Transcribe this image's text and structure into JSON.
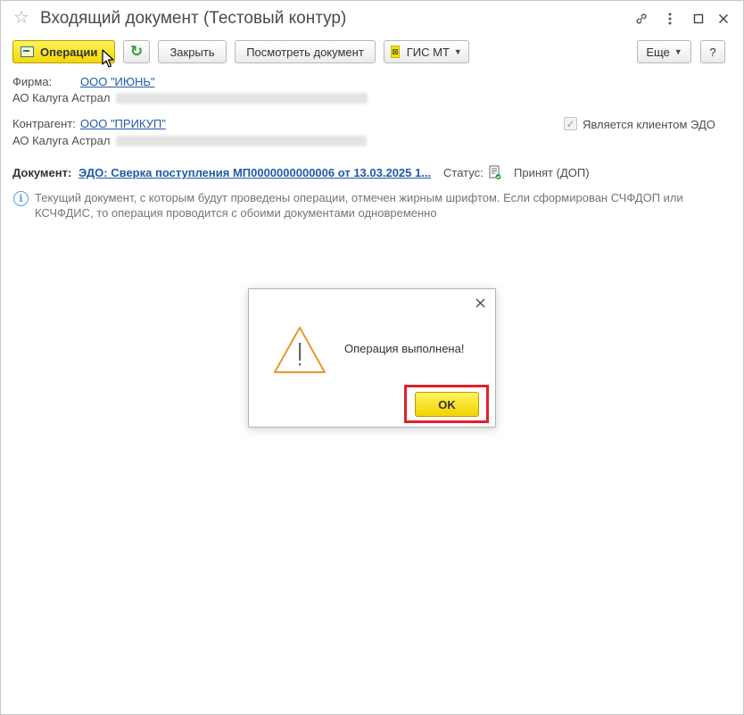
{
  "window": {
    "title": "Входящий документ (Тестовый контур)",
    "icons": [
      "star-icon",
      "link-icon",
      "more-icon",
      "minimize-icon",
      "close-icon"
    ]
  },
  "toolbar": {
    "operations_label": "Операции",
    "close_label": "Закрыть",
    "view_document_label": "Посмотреть документ",
    "gis_mt_label": "ГИС МТ",
    "more_label": "Еще",
    "help_label": "?"
  },
  "firm": {
    "label": "Фирма:",
    "value": "ООО \"ИЮНЬ\"",
    "sub_label": "АО Калуга Астрал"
  },
  "counterparty": {
    "label": "Контрагент:",
    "value": "ООО \"ПРИКУП\"",
    "sub_label": "АО Калуга Астрал",
    "edo_client_label": "Является клиентом ЭДО",
    "edo_client_checked": true
  },
  "document": {
    "label": "Документ:",
    "value": "ЭДО: Сверка поступления МП0000000000006 от 13.03.2025 1...",
    "status_label": "Статус:",
    "status_value": "Принят (ДОП)"
  },
  "info": {
    "text": "Текущий документ, с которым будут проведены операции, отмечен жирным шрифтом. Если сформирован СЧФДОП или КСЧФДИС, то операция проводится с обоими документами одновременно"
  },
  "dialog": {
    "message": "Операция выполнена!",
    "ok_label": "OK"
  },
  "colors": {
    "accent_yellow": "#f2d800",
    "link_blue": "#1f5aa8",
    "highlight_red": "#e0212b",
    "warning_orange": "#e8962e"
  }
}
